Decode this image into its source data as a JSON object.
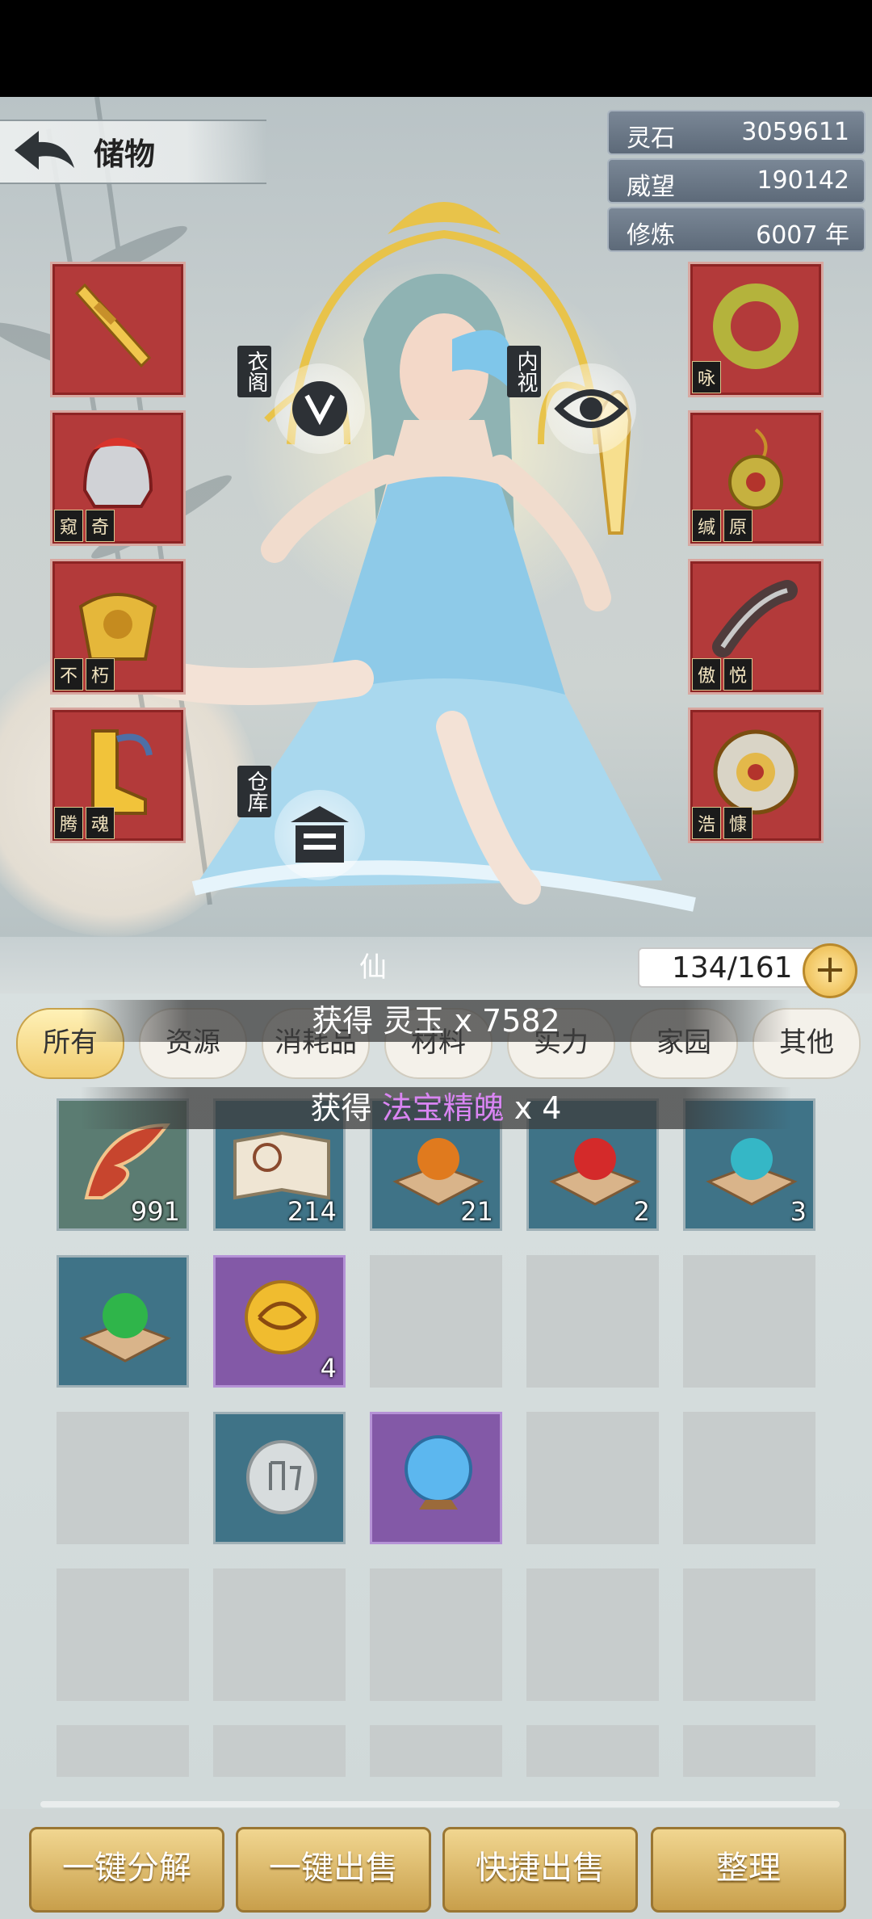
{
  "header": {
    "title": "储物"
  },
  "currencies": [
    {
      "label": "灵石",
      "value": "3059611"
    },
    {
      "label": "威望",
      "value": "190142"
    },
    {
      "label": "修炼",
      "value": "6007 年"
    }
  ],
  "ring_buttons": {
    "wardrobe": "衣阁",
    "inner_view": "内视",
    "warehouse": "仓库"
  },
  "equipment_left": [
    {
      "name": "sword",
      "seal": []
    },
    {
      "name": "helmet",
      "seal": [
        "窥",
        "奇"
      ]
    },
    {
      "name": "armor",
      "seal": [
        "不",
        "朽"
      ]
    },
    {
      "name": "boots",
      "seal": [
        "腾",
        "魂"
      ]
    }
  ],
  "equipment_right": [
    {
      "name": "jade-ring",
      "seal": [
        "咏"
      ]
    },
    {
      "name": "amulet",
      "seal": [
        "缄",
        "原"
      ]
    },
    {
      "name": "bracer",
      "seal": [
        "傲",
        "悦"
      ]
    },
    {
      "name": "shield",
      "seal": [
        "浩",
        "慷"
      ]
    }
  ],
  "bag": {
    "section_label": "仙",
    "capacity": "134/161",
    "add_label": "+",
    "tabs": [
      "所有",
      "资源",
      "消耗品",
      "材料",
      "实力",
      "家园",
      "其他"
    ],
    "active_tab": "所有"
  },
  "toasts": [
    {
      "prefix": "获得 ",
      "item": "灵玉",
      "suffix": " x 7582"
    },
    {
      "prefix": "获得 ",
      "item": "法宝精魄",
      "suffix": " x 4"
    }
  ],
  "inventory": [
    {
      "icon": "feather-icon",
      "count": "991",
      "rarity": "green"
    },
    {
      "icon": "book-icon",
      "count": "214",
      "rarity": "blue"
    },
    {
      "icon": "orange-orb-box-icon",
      "count": "21",
      "rarity": "blue"
    },
    {
      "icon": "red-orb-box-icon",
      "count": "2",
      "rarity": "blue"
    },
    {
      "icon": "cyan-orb-box-icon",
      "count": "3",
      "rarity": "blue"
    },
    {
      "icon": "green-orb-box-icon",
      "count": "",
      "rarity": "blue"
    },
    {
      "icon": "golden-dragon-orb-icon",
      "count": "4",
      "rarity": "purple"
    },
    {
      "icon": "silver-rune-stone-icon",
      "count": "",
      "rarity": "blue"
    },
    {
      "icon": "blue-crystal-ball-icon",
      "count": "",
      "rarity": "purple"
    }
  ],
  "actions": [
    "一键分解",
    "一键出售",
    "快捷出售",
    "整理"
  ],
  "colors": {
    "equip_bg": "#b33a3a",
    "gold_button": "#e0bd6a",
    "purple_rarity": "#8359a7",
    "blue_rarity": "#3f7387"
  }
}
